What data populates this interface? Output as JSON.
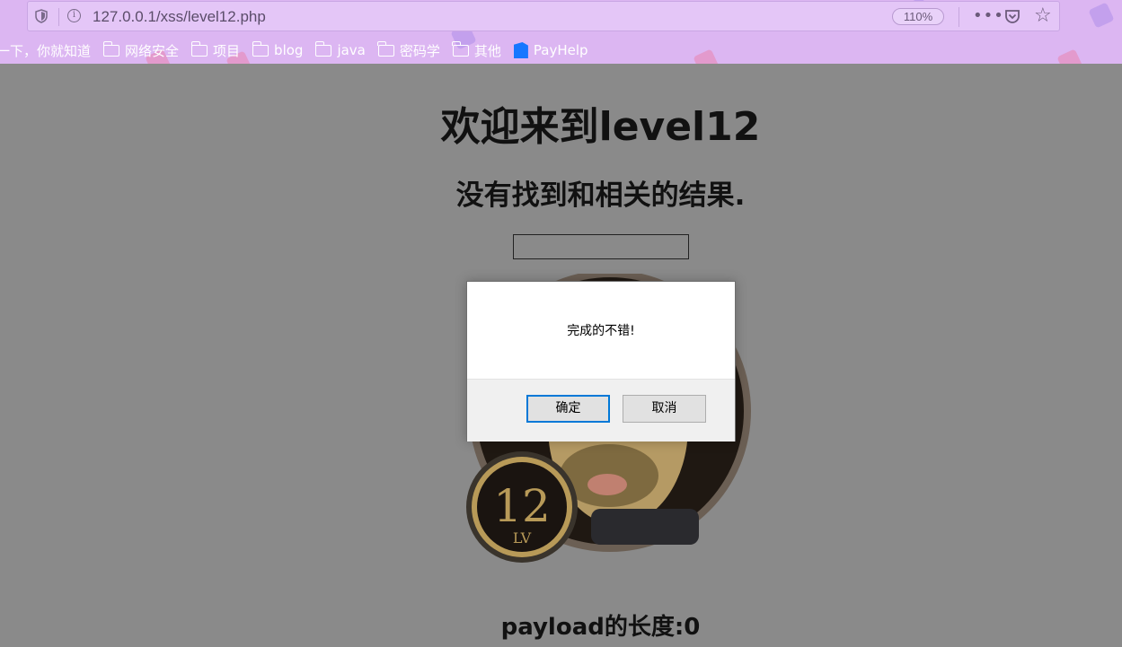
{
  "browser": {
    "url": "127.0.0.1/xss/level12.php",
    "zoom": "110%",
    "menu_glyph": "•••",
    "star_glyph": "☆",
    "info_glyph": "i",
    "bookmarks": [
      {
        "label": "一下，你就知道",
        "icon": "none"
      },
      {
        "label": "网络安全",
        "icon": "folder-icon"
      },
      {
        "label": "项目",
        "icon": "folder-icon"
      },
      {
        "label": "blog",
        "icon": "folder-icon"
      },
      {
        "label": "java",
        "icon": "folder-icon"
      },
      {
        "label": "密码学",
        "icon": "folder-icon"
      },
      {
        "label": "其他",
        "icon": "folder-icon"
      },
      {
        "label": "PayHelp",
        "icon": "payhelp-icon"
      }
    ]
  },
  "page": {
    "title": "欢迎来到level12",
    "subtitle": "没有找到和相关的结果.",
    "search_value": "",
    "badge_number": "12",
    "badge_unit": "LV",
    "payload_text": "payload的长度:0"
  },
  "dialog": {
    "message": "完成的不错!",
    "ok_label": "确定",
    "cancel_label": "取消"
  },
  "colors": {
    "chrome_bg": "#dcb6f2",
    "page_overlay": "#8a8a8a",
    "dialog_focus": "#0078d7"
  }
}
